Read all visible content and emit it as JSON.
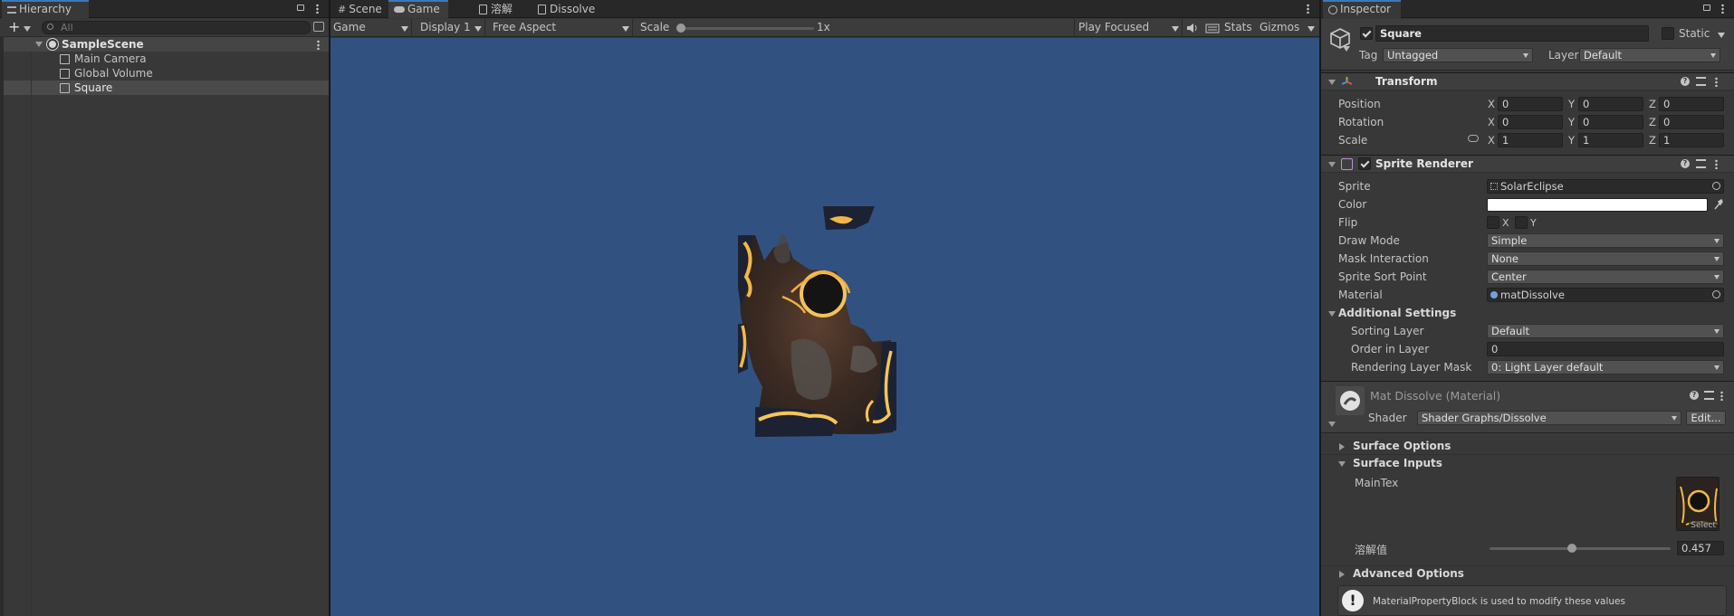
{
  "hierarchy": {
    "tab_label": "Hierarchy",
    "search_placeholder": "All",
    "scene_name": "SampleScene",
    "items": [
      {
        "label": "Main Camera"
      },
      {
        "label": "Global Volume"
      },
      {
        "label": "Square"
      }
    ]
  },
  "center_tabs": {
    "scene": "Scene",
    "game": "Game",
    "tab3": "溶解",
    "tab4": "Dissolve"
  },
  "game_toolbar": {
    "view_mode": "Game",
    "display": "Display 1",
    "aspect": "Free Aspect",
    "scale_label": "Scale",
    "scale_value": "1x",
    "scale_fraction": 0.0,
    "play_mode": "Play Focused",
    "stats": "Stats",
    "gizmos": "Gizmos"
  },
  "colors": {
    "game_background": "#315281",
    "accent": "#3a79bb"
  },
  "inspector": {
    "tab_label": "Inspector",
    "object_name": "Square",
    "active": true,
    "static_label": "Static",
    "tag_label": "Tag",
    "tag_value": "Untagged",
    "layer_label": "Layer",
    "layer_value": "Default",
    "transform": {
      "title": "Transform",
      "position_label": "Position",
      "rotation_label": "Rotation",
      "scale_label": "Scale",
      "position": {
        "x": "0",
        "y": "0",
        "z": "0"
      },
      "rotation": {
        "x": "0",
        "y": "0",
        "z": "0"
      },
      "scale": {
        "x": "1",
        "y": "1",
        "z": "1"
      }
    },
    "sprite_renderer": {
      "title": "Sprite Renderer",
      "enabled": true,
      "sprite_label": "Sprite",
      "sprite_value": "SolarEclipse",
      "color_label": "Color",
      "color_value": "#ffffff",
      "flip_label": "Flip",
      "flip_x": "X",
      "flip_y": "Y",
      "draw_mode_label": "Draw Mode",
      "draw_mode_value": "Simple",
      "mask_label": "Mask Interaction",
      "mask_value": "None",
      "sort_point_label": "Sprite Sort Point",
      "sort_point_value": "Center",
      "material_label": "Material",
      "material_value": "matDissolve",
      "additional_title": "Additional Settings",
      "sorting_layer_label": "Sorting Layer",
      "sorting_layer_value": "Default",
      "order_label": "Order in Layer",
      "order_value": "0",
      "rlm_label": "Rendering Layer Mask",
      "rlm_value": "0: Light Layer default"
    },
    "material": {
      "title": "Mat Dissolve (Material)",
      "shader_label": "Shader",
      "shader_value": "Shader Graphs/Dissolve",
      "edit_label": "Edit...",
      "surface_options": "Surface Options",
      "surface_inputs": "Surface Inputs",
      "maintex_label": "MainTex",
      "select_label": "Select",
      "dissolve_label": "溶解值",
      "dissolve_value": "0.457",
      "dissolve_fraction": 0.457,
      "advanced": "Advanced Options",
      "help_text": "MaterialPropertyBlock is used to modify these values"
    }
  }
}
